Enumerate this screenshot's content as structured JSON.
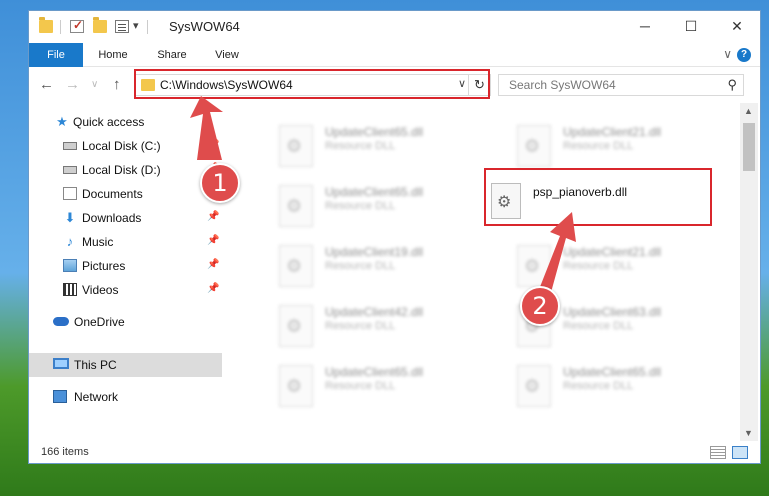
{
  "window": {
    "title": "SysWOW64",
    "controls": {
      "minimize": "─",
      "maximize": "☐",
      "close": "✕"
    }
  },
  "quick_access_toolbar": {
    "icons": [
      "folder-icon",
      "properties-check-icon",
      "new-folder-icon",
      "customize-icon"
    ],
    "dropdown": "▾"
  },
  "ribbon": {
    "tabs": [
      "File",
      "Home",
      "Share",
      "View"
    ],
    "collapse_glyph": "∨",
    "help_glyph": "?"
  },
  "navigation": {
    "back": "←",
    "forward": "→",
    "recent": "∨",
    "up": "↑",
    "address": "C:\\Windows\\SysWOW64",
    "address_dropdown": "∨",
    "refresh": "↻",
    "search_placeholder": "Search SysWOW64",
    "search_glyph": "⚲"
  },
  "sidebar": {
    "items": [
      {
        "label": "Quick access",
        "icon": "star-icon",
        "glyph": "★",
        "pinned": false
      },
      {
        "label": "Local Disk (C:)",
        "icon": "disk-icon",
        "glyph": "",
        "pinned": true
      },
      {
        "label": "Local Disk (D:)",
        "icon": "disk-icon",
        "glyph": "",
        "pinned": true
      },
      {
        "label": "Documents",
        "icon": "documents-icon",
        "glyph": "",
        "pinned": true
      },
      {
        "label": "Downloads",
        "icon": "download-icon",
        "glyph": "⬇",
        "pinned": true
      },
      {
        "label": "Music",
        "icon": "music-icon",
        "glyph": "♪",
        "pinned": true
      },
      {
        "label": "Pictures",
        "icon": "pictures-icon",
        "glyph": "",
        "pinned": true
      },
      {
        "label": "Videos",
        "icon": "videos-icon",
        "glyph": "",
        "pinned": true
      },
      {
        "label": "OneDrive",
        "icon": "cloud-icon",
        "glyph": "",
        "pinned": false
      },
      {
        "label": "This PC",
        "icon": "computer-icon",
        "glyph": "",
        "pinned": false,
        "selected": true
      },
      {
        "label": "Network",
        "icon": "network-icon",
        "glyph": "",
        "pinned": false
      }
    ],
    "pin_glyph": "📌"
  },
  "files": [
    {
      "name": "UpdateClient65.dll",
      "type": "Resource DLL",
      "blurred": true
    },
    {
      "name": "UpdateClient21.dll",
      "type": "Resource DLL",
      "blurred": true
    },
    {
      "name": "UpdateClient65.dll",
      "type": "Resource DLL",
      "blurred": true
    },
    {
      "name": "psp_pianoverb.dll",
      "type": "",
      "blurred": false
    },
    {
      "name": "UpdateClient19.dll",
      "type": "Resource DLL",
      "blurred": true
    },
    {
      "name": "UpdateClient21.dll",
      "type": "Resource DLL",
      "blurred": true
    },
    {
      "name": "UpdateClient42.dll",
      "type": "Resource DLL",
      "blurred": true
    },
    {
      "name": "UpdateClient63.dll",
      "type": "Resource DLL",
      "blurred": true
    },
    {
      "name": "UpdateClient65.dll",
      "type": "Resource DLL",
      "blurred": true
    },
    {
      "name": "UpdateClient65.dll",
      "type": "Resource DLL",
      "blurred": true
    }
  ],
  "scrollbar": {
    "up": "▲",
    "down": "▼",
    "position_fraction": 0.0
  },
  "status": {
    "item_count": "166 items"
  },
  "annotations": {
    "step1": "1",
    "step2": "2",
    "color": "#df4c4c"
  }
}
